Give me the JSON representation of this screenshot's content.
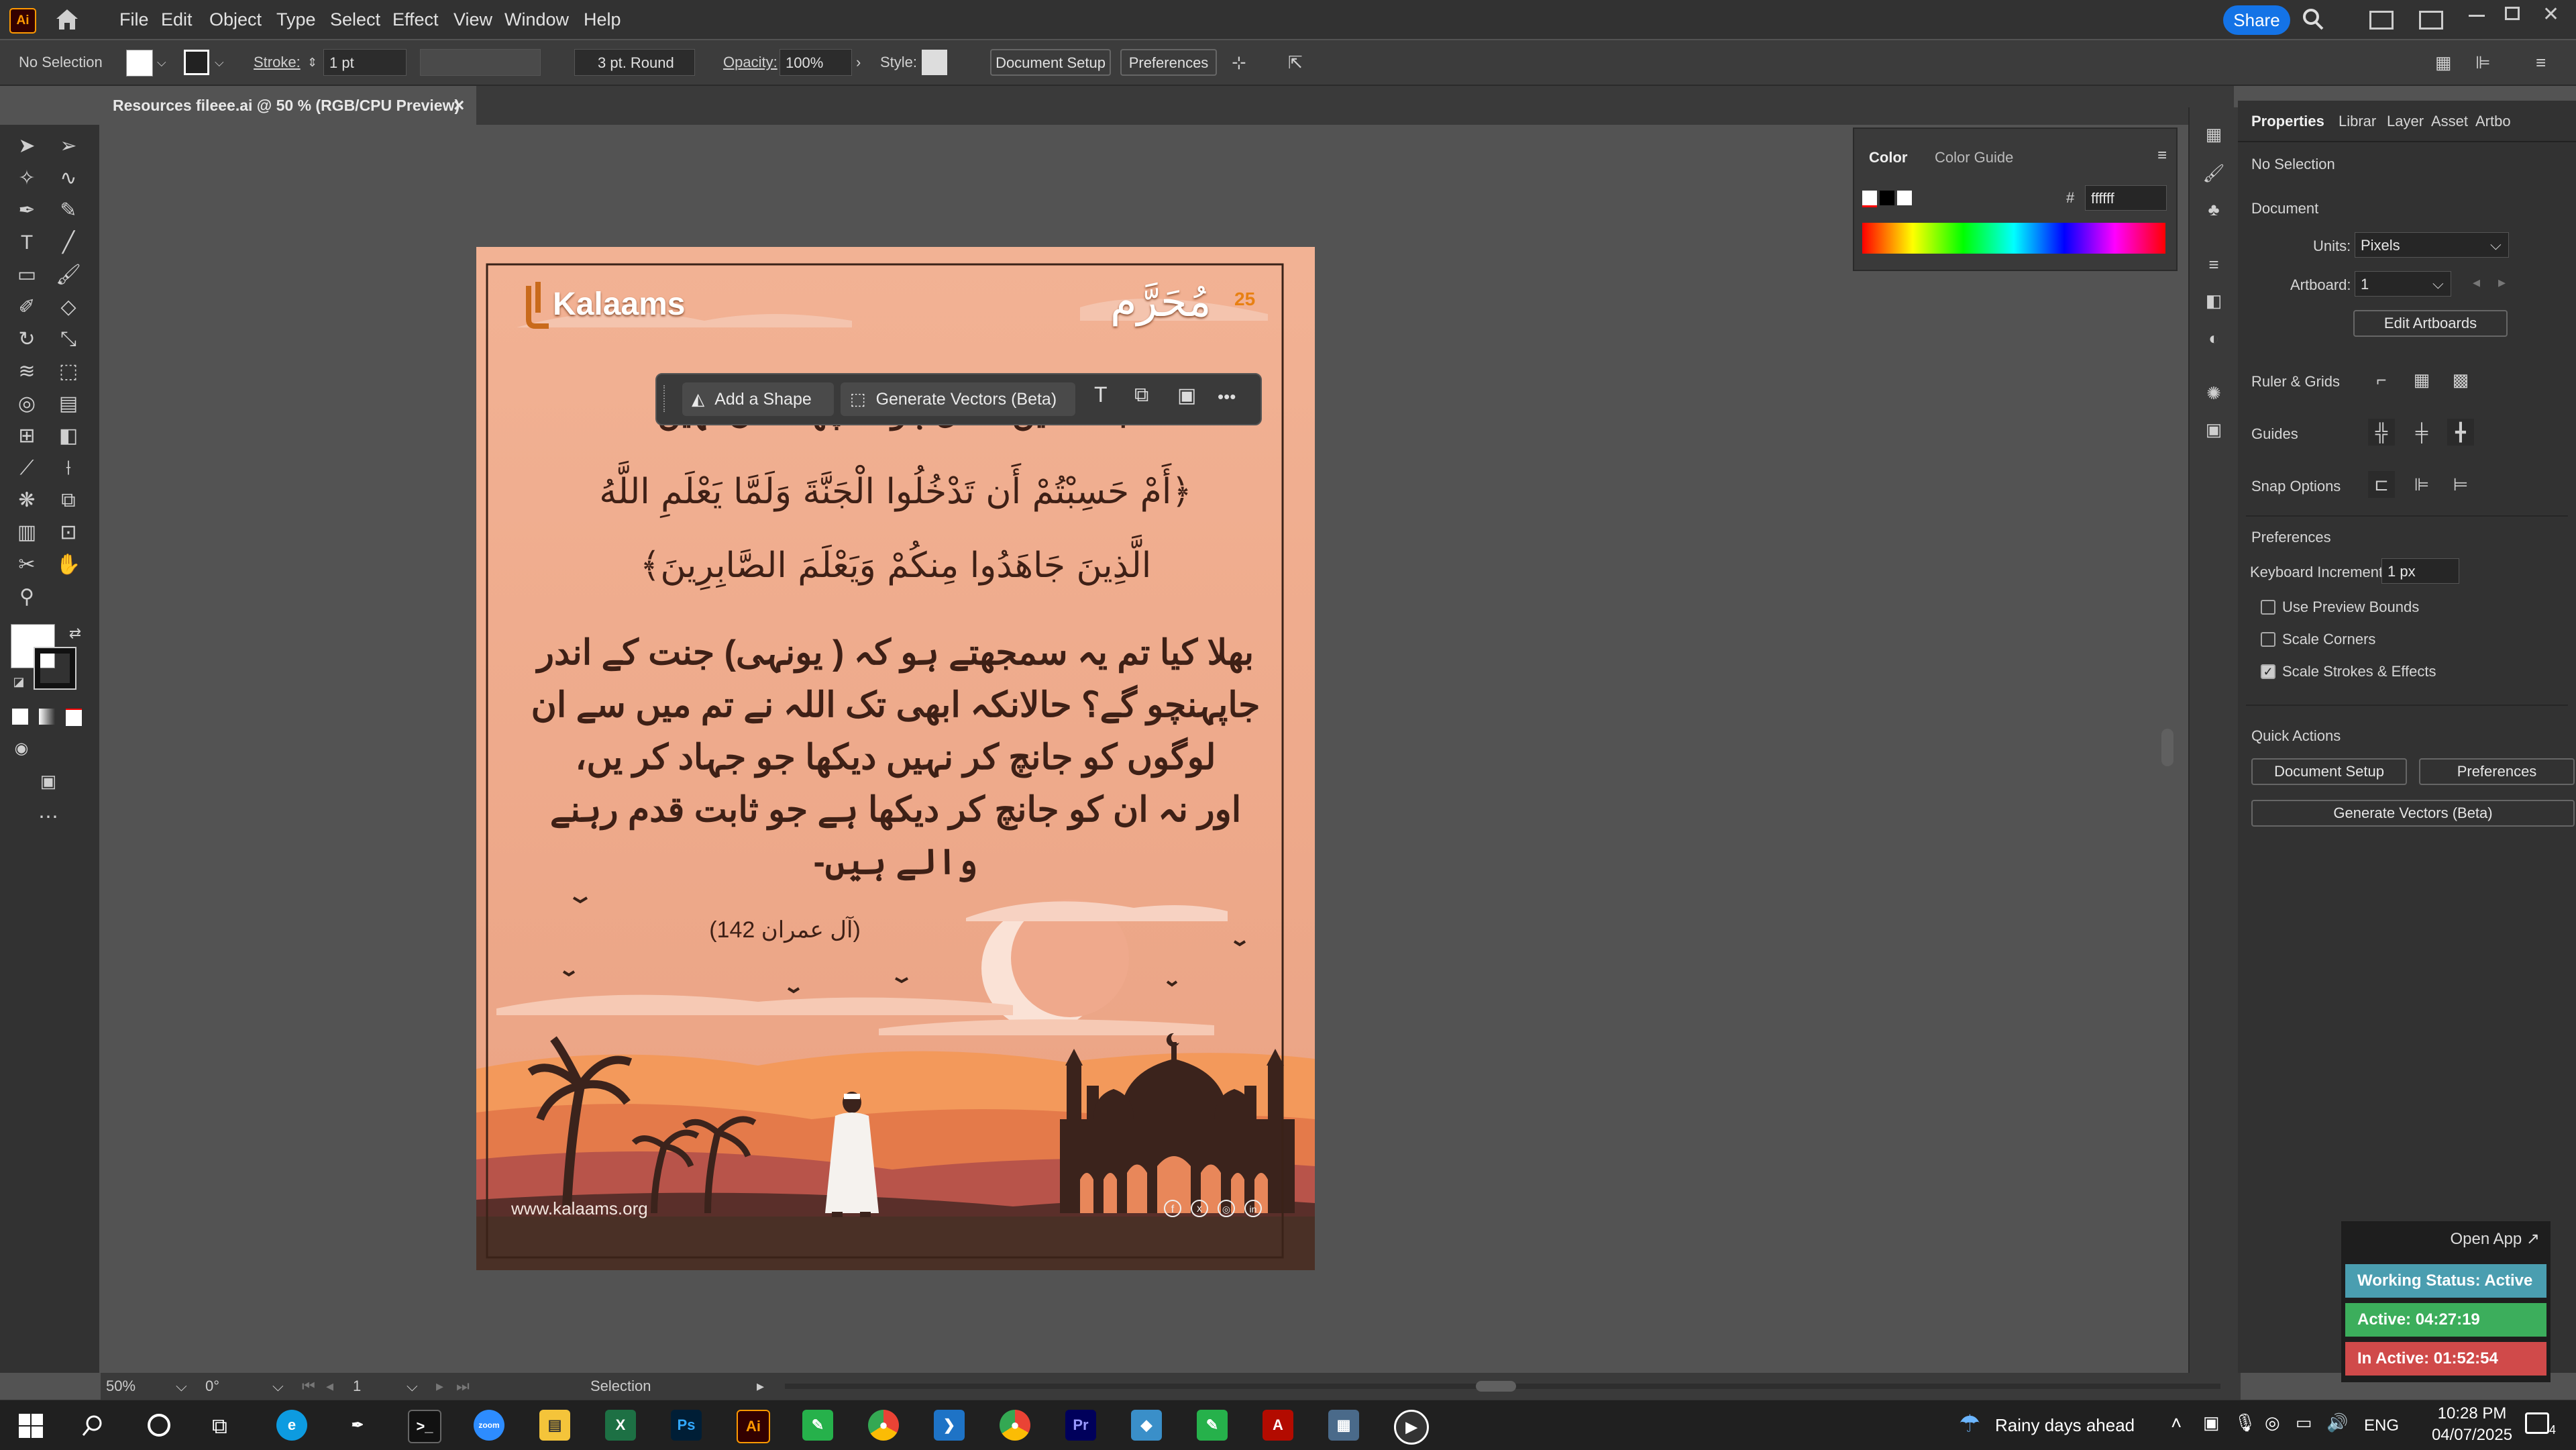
{
  "app": {
    "logo_text": "Ai",
    "menu": [
      "File",
      "Edit",
      "Object",
      "Type",
      "Select",
      "Effect",
      "View",
      "Window",
      "Help"
    ],
    "share_label": "Share"
  },
  "control_bar": {
    "selection_label": "No Selection",
    "stroke_label": "Stroke:",
    "stroke_value": "1 pt",
    "brush_value": "3 pt. Round",
    "opacity_label": "Opacity:",
    "opacity_value": "100%",
    "style_label": "Style:",
    "document_setup_label": "Document Setup",
    "preferences_label": "Preferences"
  },
  "document_tab": {
    "title": "Resources fileee.ai @ 50 % (RGB/CPU Preview)",
    "close_glyph": "×"
  },
  "artboard": {
    "brand_name": "Kalaams",
    "muharram_text": "مُحَرَّم",
    "badge_text": "25",
    "partial_top_line": "جنت میں داخل ہونا کچھ آسان نہیں",
    "arabic_line1": "﴿أَمْ حَسِبْتُمْ أَن تَدْخُلُوا الْجَنَّةَ وَلَمَّا يَعْلَمِ اللَّهُ",
    "arabic_line2": "الَّذِينَ جَاهَدُوا مِنكُمْ وَيَعْلَمَ الصَّابِرِينَ﴾",
    "urdu_lines": [
      "بھلا کیا تم یہ سمجھتے ہو کہ ( یونہی) جنت کے اندر",
      "جاپہنچو گے؟ حالانکہ ابھی تک اللہ نے تم میں سے ان",
      "لوگوں کو جانچ کر نہیں دیکھا جو جہاد کر یں،",
      "اور نہ ان کو جانچ کر دیکھا ہے جو ثابت قدم رہنے",
      "والے ہیں-"
    ],
    "reference": "(آل عمران 142)",
    "website": "www.kalaams.org",
    "social_icons": [
      "facebook-icon",
      "x-icon",
      "instagram-icon",
      "linkedin-icon"
    ]
  },
  "context_toolbar": {
    "add_shape_label": "Add a Shape",
    "generate_vectors_label": "Generate Vectors (Beta)",
    "more_glyph": "•••"
  },
  "color_panel": {
    "tab_color": "Color",
    "tab_color_guide": "Color Guide",
    "hex_label": "#",
    "hex_value": "ffffff"
  },
  "properties": {
    "tabs": [
      "Properties",
      "Librar",
      "Layer",
      "Asset",
      "Artbo"
    ],
    "no_selection": "No Selection",
    "document_heading": "Document",
    "units_label": "Units:",
    "units_value": "Pixels",
    "artboard_label": "Artboard:",
    "artboard_value": "1",
    "edit_artboards": "Edit Artboards",
    "ruler_grids": "Ruler & Grids",
    "guides": "Guides",
    "snap_options": "Snap Options",
    "preferences_heading": "Preferences",
    "keyboard_increment_label": "Keyboard Increment:",
    "keyboard_increment_value": "1 px",
    "use_preview_bounds": "Use Preview Bounds",
    "scale_corners": "Scale Corners",
    "scale_strokes": "Scale Strokes & Effects",
    "quick_actions": "Quick Actions",
    "document_setup_btn": "Document Setup",
    "preferences_btn": "Preferences",
    "generate_vectors_btn": "Generate Vectors (Beta)"
  },
  "status_bar": {
    "zoom": "50%",
    "rotation": "0°",
    "artboard_num": "1",
    "tool": "Selection"
  },
  "widget": {
    "open_app": "Open App ↗",
    "working_status": "Working Status: Active",
    "active": "Active: 04:27:19",
    "inactive": "In Active: 01:52:54",
    "colors": {
      "status": "#4a9eb0",
      "active": "#3cae5c",
      "inactive": "#d04a4a"
    }
  },
  "taskbar": {
    "weather": "Rainy days ahead",
    "language": "ENG",
    "time": "10:28 PM",
    "date": "04/07/2025",
    "notification_count": "4"
  }
}
